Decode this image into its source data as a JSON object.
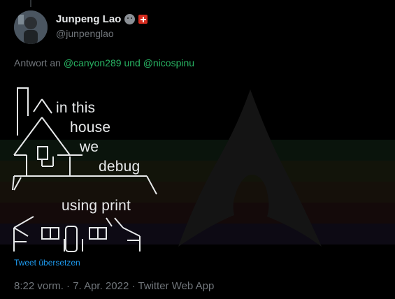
{
  "author": {
    "display_name": "Junpeng Lao",
    "handle": "@junpenglao",
    "emoji": [
      "neutral-face-emoji",
      "swiss-flag-emoji"
    ]
  },
  "reply": {
    "prefix": "Antwort an",
    "mention_1": "@canyon289",
    "connector": "und",
    "mention_2": "@nicospinu"
  },
  "media": {
    "lines": [
      "in this",
      "house",
      "we",
      "debug",
      "using print"
    ],
    "background_logo": "arch-linux-logo"
  },
  "translate_link": "Tweet übersetzen",
  "meta": {
    "time": "8:22 vorm.",
    "sep1": " · ",
    "date": "7. Apr. 2022",
    "sep2": " · ",
    "source": "Twitter Web App"
  },
  "colors": {
    "background": "#000000",
    "text": "#e7e9ea",
    "secondary": "#71767b",
    "link": "#1d9bf0"
  }
}
